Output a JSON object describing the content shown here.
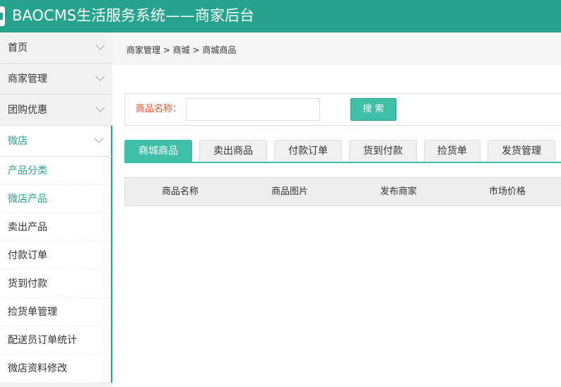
{
  "header": {
    "title": "BAOCMS生活服务系统——商家后台"
  },
  "sidebar": {
    "groups": [
      {
        "label": "首页"
      },
      {
        "label": "商家管理"
      },
      {
        "label": "团购优惠"
      },
      {
        "label": "微店"
      }
    ],
    "submenu": [
      {
        "label": "产品分类"
      },
      {
        "label": "微店产品"
      },
      {
        "label": "卖出产品"
      },
      {
        "label": "付款订单"
      },
      {
        "label": "货到付款"
      },
      {
        "label": "捡货单管理"
      },
      {
        "label": "配送员订单统计"
      },
      {
        "label": "微店资料修改"
      }
    ]
  },
  "breadcrumb": {
    "text": "商家管理 > 商城 > 商城商品"
  },
  "search": {
    "label": "商品名称：",
    "value": "",
    "button_label": "搜 索"
  },
  "tabs": [
    {
      "label": "商城商品"
    },
    {
      "label": "卖出商品"
    },
    {
      "label": "付款订单"
    },
    {
      "label": "货到付款"
    },
    {
      "label": "捡货单"
    },
    {
      "label": "发货管理"
    }
  ],
  "table": {
    "columns": [
      "商品名称",
      "商品图片",
      "发布商家",
      "市场价格"
    ]
  },
  "colors": {
    "accent": "#26a38f",
    "button": "#3fbfa7",
    "search_label": "#e4572e"
  }
}
